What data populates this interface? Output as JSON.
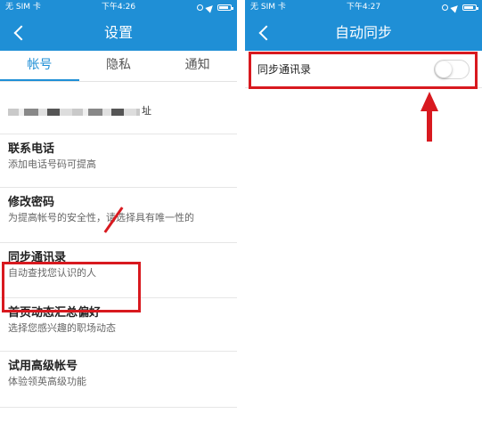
{
  "left": {
    "status": {
      "carrier": "无 SIM 卡",
      "time": "下午4:26"
    },
    "nav": {
      "title": "设置"
    },
    "tabs": [
      "帐号",
      "隐私",
      "通知"
    ],
    "rows": [
      {
        "title": "",
        "subtitle": "址"
      },
      {
        "title": "联系电话",
        "subtitle": "添加电话号码可提高"
      },
      {
        "title": "修改密码",
        "subtitle": "为提高帐号的安全性，请选择具有唯一性的"
      },
      {
        "title": "同步通讯录",
        "subtitle": "自动查找您认识的人"
      },
      {
        "title": "首页动态汇总偏好",
        "subtitle": "选择您感兴趣的职场动态"
      },
      {
        "title": "试用高级帐号",
        "subtitle": "体验领英高级功能"
      }
    ]
  },
  "right": {
    "status": {
      "carrier": "无 SIM 卡",
      "time": "下午4:27"
    },
    "nav": {
      "title": "自动同步"
    },
    "sync": {
      "label": "同步通讯录",
      "enabled": false
    }
  },
  "colors": {
    "accent": "#1f8fd6",
    "annotation": "#d8191f"
  },
  "icons": [
    "back-chevron-icon",
    "wifi-icon",
    "location-icon",
    "battery-icon",
    "rotation-lock-icon"
  ]
}
